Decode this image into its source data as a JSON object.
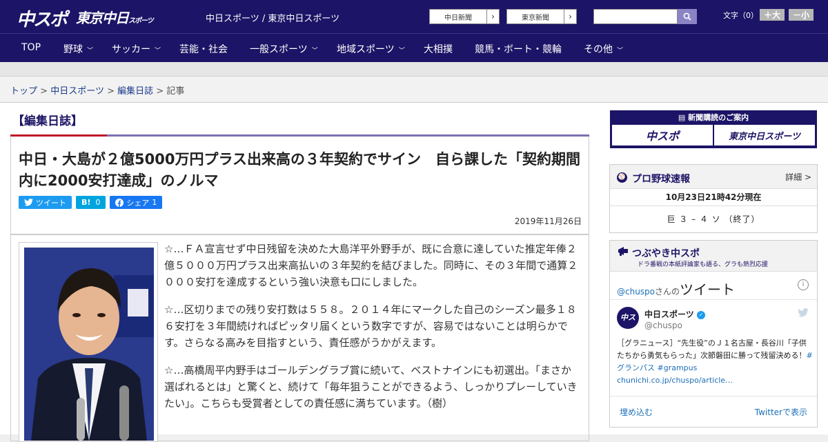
{
  "header": {
    "logo_main": "中スポ",
    "logo_tokyo": "東京中日",
    "logo_tokyo_sub": "スポーツ",
    "site_link": "中日スポーツ / 東京中日スポーツ",
    "ext_links": [
      "中日新聞",
      "東京新聞"
    ],
    "search_placeholder": "",
    "font_size_label": "文字（0）",
    "font_plus": "＋大",
    "font_minus": "－小"
  },
  "nav": {
    "items": [
      {
        "label": "TOP",
        "dropdown": false
      },
      {
        "label": "野球",
        "dropdown": true
      },
      {
        "label": "サッカー",
        "dropdown": true
      },
      {
        "label": "芸能・社会",
        "dropdown": false
      },
      {
        "label": "一般スポーツ",
        "dropdown": true
      },
      {
        "label": "地域スポーツ",
        "dropdown": true
      },
      {
        "label": "大相撲",
        "dropdown": false
      },
      {
        "label": "競馬・ボート・競輪",
        "dropdown": false
      },
      {
        "label": "その他",
        "dropdown": true
      }
    ]
  },
  "breadcrumb": {
    "items": [
      "トップ",
      "中日スポーツ",
      "編集日誌"
    ],
    "separator": ">",
    "current": "記事"
  },
  "article": {
    "section": "【編集日誌】",
    "headline": "中日・大島が２億5000万円プラス出来高の３年契約でサイン　自ら課した「契約期間内に2000安打達成」のノルマ",
    "share": {
      "tweet": "ツイート",
      "hatena": "B!",
      "hatena_count": "0",
      "facebook": "シェア",
      "facebook_count": "1"
    },
    "date": "2019年11月26日",
    "paragraphs": [
      "☆…ＦＡ宣言せず中日残留を決めた大島洋平外野手が、既に合意に達していた推定年俸２億５０００万円プラス出来高払いの３年契約を結びました。同時に、その３年間で通算２０００安打を達成するという強い決意も口にしました。",
      "☆…区切りまでの残り安打数は５５８。２０１４年にマークした自己のシーズン最多１８６安打を３年間続ければピッタリ届くという数字ですが、容易ではないことは明らかです。さらなる高みを目指すという、責任感がうかがえます。",
      "☆…高橋周平内野手はゴールデングラブ賞に続いて、ベストナインにも初選出。「まさか選ばれるとは」と驚くと、続けて「毎年狙うことができるよう、しっかりプレーしていきたい」。こちらも受賞者としての責任感に満ちています。（樹）"
    ]
  },
  "sidebar": {
    "subscribe": {
      "caption": "新聞購読のご案内",
      "brand1": "中スポ",
      "brand2": "東京中日スポーツ"
    },
    "baseball": {
      "title": "プロ野球速報",
      "more": "詳細 >",
      "timestamp": "10月23日21時42分現在",
      "score": "巨 ３ – ４ ソ （終了）"
    },
    "tweets": {
      "title": "つぶやき中スポ",
      "subtitle": "ドラ番戦の本紙評論家も語る、グラも熱烈応援",
      "handle_prefix": "@chuspo",
      "handle_suffix": "さんの",
      "heading": "ツイート",
      "account_name": "中日スポーツ",
      "account_handle": "@chuspo",
      "tweet_text_plain": "［グラニュース］“先生役”のＪ１名古屋・長谷川「子供たちから勇気もらった」次節磐田に勝って残留決める！",
      "tweet_tags": "#グランパス #grampus",
      "tweet_link": "chunichi.co.jp/chuspo/article…",
      "embed": "埋め込む",
      "view_on_twitter": "Twitterで表示"
    }
  }
}
